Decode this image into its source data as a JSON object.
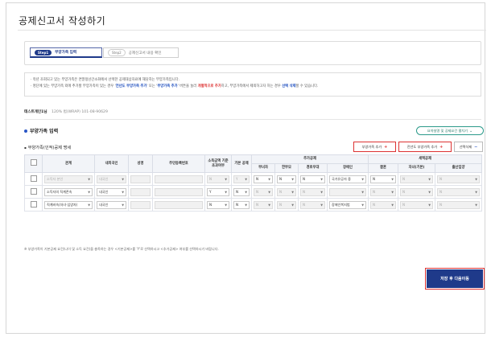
{
  "page": {
    "title": "공제신고서 작성하기"
  },
  "tabs": [
    {
      "step": "Step1",
      "label": "부양가족 입력"
    },
    {
      "step": "Step2",
      "label": "공제신고서 내용 확인"
    }
  ],
  "notice": {
    "line1": "· 작년 조회되고 있는 부양가족은 연말정산간소화에서 선택한 공제대상자료에 해당하는 부양가족입니다.",
    "line2_a": "· 명단에 있는 부양가족 외에 추가할 부양가족이 있는 경우 '",
    "line2_b": "전년도 부양가족 추가",
    "line2_c": "' 또는 '",
    "line2_d": "부양가족 추가",
    "line2_e": "' 버튼을 눌러 ",
    "line2_f": "개별적으로 추가",
    "line2_g": "하고, 부양가족에서 제외하고자 하는 경우 ",
    "line2_h": "선택 삭제",
    "line2_i": "할 수 있습니다."
  },
  "company": {
    "name": "테스트개인1님",
    "info": "120% 법(WRAP) 101-08-90629"
  },
  "section": {
    "title": "부양가족 입력",
    "toggle_label": "요약설명 및 공제요건 펼치기"
  },
  "subsection": {
    "title": "부양가족(인적)공제 명세"
  },
  "actions": {
    "add": "부양가족 추가",
    "add_prev": "전년도 부양가족 추가",
    "delete": "선택삭제"
  },
  "table": {
    "headers": {
      "relation": "관계",
      "nationality": "내외국인",
      "name": "성명",
      "rrn": "주민등록번호",
      "income": "소득금액 기준 초과여부",
      "basic": "기본 공제",
      "extra_group": "추가공제",
      "single_mother": "부녀자",
      "single_parent": "한부모",
      "senior": "경로우대",
      "disabled": "장애인",
      "tax_group": "세액공제",
      "marriage": "결혼",
      "child": "자녀(기본)",
      "birth": "출산입양"
    },
    "rows": [
      {
        "relation": "소득자 본인",
        "nationality": "내국인",
        "income": "N",
        "basic": "Y",
        "single_mother": "N",
        "single_parent": "N",
        "senior": "N",
        "disabled": "국가유공자 중",
        "marriage": "N",
        "child": "N",
        "birth": "N"
      },
      {
        "relation": "소득자의 직계존속",
        "nationality": "내국인",
        "income": "Y",
        "basic": "N",
        "single_mother": "N",
        "single_parent": "N",
        "senior": "N",
        "disabled": "",
        "marriage": "N",
        "child": "N",
        "birth": "N"
      },
      {
        "relation": "직계비속(자녀·입양자)",
        "nationality": "내국인",
        "income": "N",
        "basic": "N",
        "single_mother": "N",
        "single_parent": "N",
        "senior": "N",
        "disabled": "장애인복지법",
        "marriage": "N",
        "child": "N",
        "birth": "N"
      }
    ]
  },
  "footnote": "※ 부양가족이 기본공제 요건(나이 및 소득 요건)을 충족하는 경우 <기본공제>를 'Y'로 선택하시고 <추가공제> 여부를 선택하시기 바랍니다.",
  "save_label": "저장 후 다음이동"
}
